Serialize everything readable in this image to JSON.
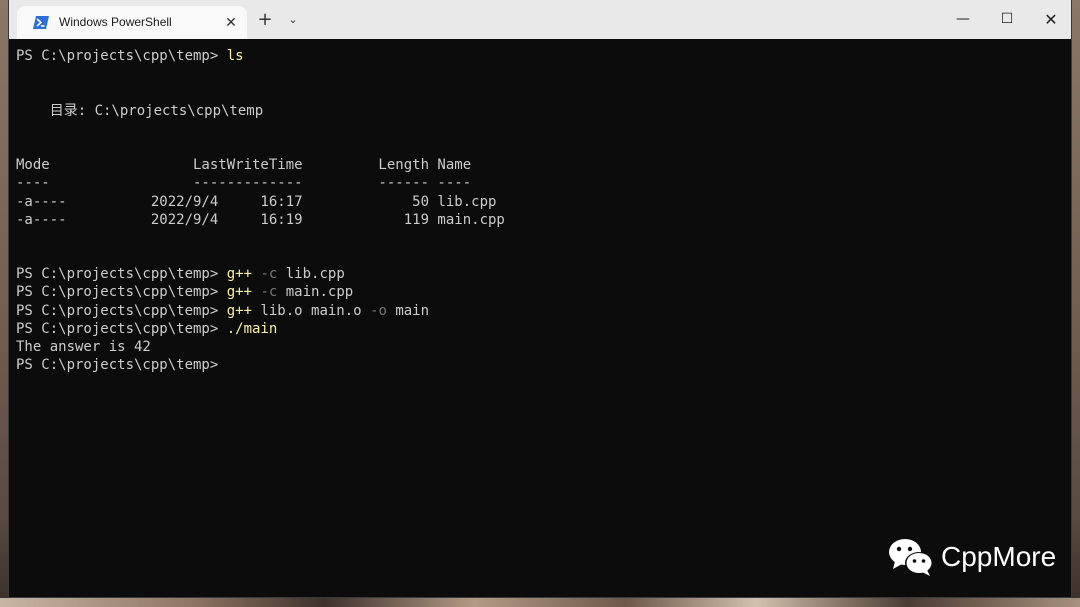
{
  "window": {
    "tab_title": "Windows PowerShell",
    "tab_close_glyph": "✕",
    "new_tab_glyph": "+",
    "dropdown_glyph": "⌄",
    "minimize_glyph": "—",
    "maximize_glyph": "☐",
    "close_glyph": "✕",
    "tab_icon": "powershell-icon"
  },
  "terminal": {
    "prompt": "PS C:\\projects\\cpp\\temp> ",
    "cmd_ls": "ls",
    "dir_header": "    目录: C:\\projects\\cpp\\temp",
    "table_header": "Mode                 LastWriteTime         Length Name",
    "table_rule": "----                 -------------         ------ ----",
    "rows": [
      "-a----          2022/9/4     16:17             50 lib.cpp",
      "-a----          2022/9/4     16:19            119 main.cpp"
    ],
    "cmd1": {
      "exe": "g++",
      "flag": " -c",
      "args": " lib.cpp"
    },
    "cmd2": {
      "exe": "g++",
      "flag": " -c",
      "args": " main.cpp"
    },
    "cmd3": {
      "exe": "g++",
      "args1": " lib.o main.o",
      "flag": " -o",
      "args2": " main"
    },
    "cmd4": {
      "exe": "./main"
    },
    "output": "The answer is 42"
  },
  "watermark": {
    "text": "CppMore",
    "icon": "wechat-icon"
  },
  "colors": {
    "terminal_bg": "#0c0c0c",
    "terminal_fg": "#cccccc",
    "command": "#f9f1a5",
    "flag": "#767676",
    "titlebar": "#e9e9e9"
  }
}
